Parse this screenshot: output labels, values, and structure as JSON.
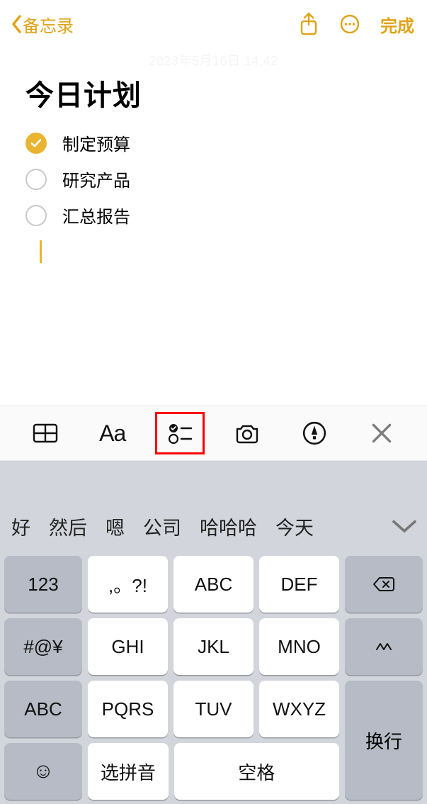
{
  "nav": {
    "back_label": "备忘录",
    "done_label": "完成"
  },
  "note": {
    "timestamp": "2023年5月16日 14:42",
    "title": "今日计划",
    "items": [
      {
        "text": "制定预算",
        "checked": true
      },
      {
        "text": "研究产品",
        "checked": false
      },
      {
        "text": "汇总报告",
        "checked": false
      }
    ]
  },
  "format_toolbar": {
    "aa_label": "Aa"
  },
  "suggestions": {
    "items": [
      "好",
      "然后",
      "嗯",
      "公司",
      "哈哈哈",
      "今天"
    ]
  },
  "keyboard": {
    "rows": [
      [
        "123",
        ",。?!",
        "ABC",
        "DEF"
      ],
      [
        "#@¥",
        "GHI",
        "JKL",
        "MNO"
      ],
      [
        "ABC",
        "PQRS",
        "TUV",
        "WXYZ"
      ]
    ],
    "backspace_icon": "backspace",
    "caret_label": "^^",
    "enter_label": "换行",
    "pinyin_label": "选拼音",
    "space_label": "空格"
  }
}
